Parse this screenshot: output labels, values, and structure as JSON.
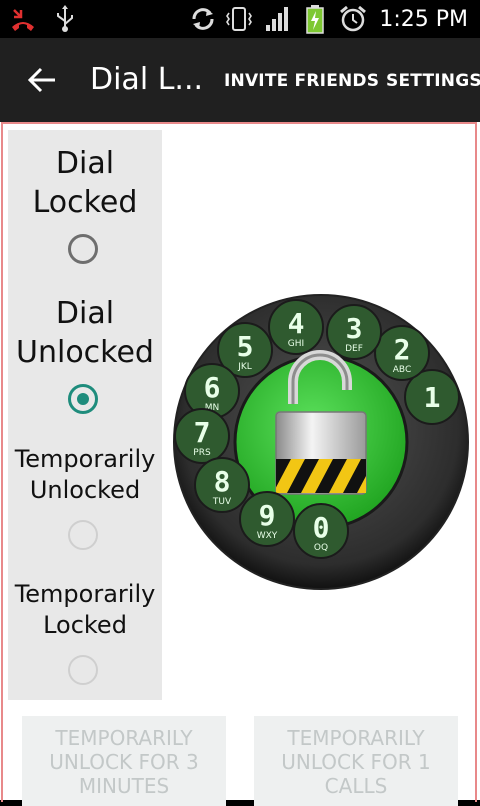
{
  "status_bar": {
    "time": "1:25 PM",
    "icons": [
      "missed-call-icon",
      "usb-icon",
      "sync-icon",
      "vibrate-icon",
      "signal-icon",
      "battery-charging-icon",
      "alarm-icon"
    ]
  },
  "action_bar": {
    "title": "Dial L...",
    "invite_label": "INVITE FRIENDS",
    "settings_label": "SETTINGS"
  },
  "options": [
    {
      "label": "Dial Locked",
      "checked": false
    },
    {
      "label": "Dial Unlocked",
      "checked": true
    },
    {
      "label": "Temporarily Unlocked",
      "checked": false,
      "enabled": false
    },
    {
      "label": "Temporarily Locked",
      "checked": false,
      "enabled": false
    }
  ],
  "dial": {
    "keys": [
      {
        "digit": "1",
        "letters": ""
      },
      {
        "digit": "2",
        "letters": "ABC"
      },
      {
        "digit": "3",
        "letters": "DEF"
      },
      {
        "digit": "4",
        "letters": "GHI"
      },
      {
        "digit": "5",
        "letters": "JKL"
      },
      {
        "digit": "6",
        "letters": "MN"
      },
      {
        "digit": "7",
        "letters": "PRS"
      },
      {
        "digit": "8",
        "letters": "TUV"
      },
      {
        "digit": "9",
        "letters": "WXY"
      },
      {
        "digit": "0",
        "letters": "OQ"
      }
    ],
    "colors": {
      "ring": "#3a3a3a",
      "center": "#31c831",
      "key": "#2f5a2f",
      "key_text": "#e8ffe8"
    }
  },
  "buttons": {
    "temp_unlock_minutes": "TEMPORARILY UNLOCK FOR 3 MINUTES",
    "temp_unlock_calls": "TEMPORARILY UNLOCK FOR 1 CALLS"
  },
  "colors": {
    "accent": "#1e8c7c",
    "frame": "#e8898a",
    "panel": "#e8e8e8"
  }
}
